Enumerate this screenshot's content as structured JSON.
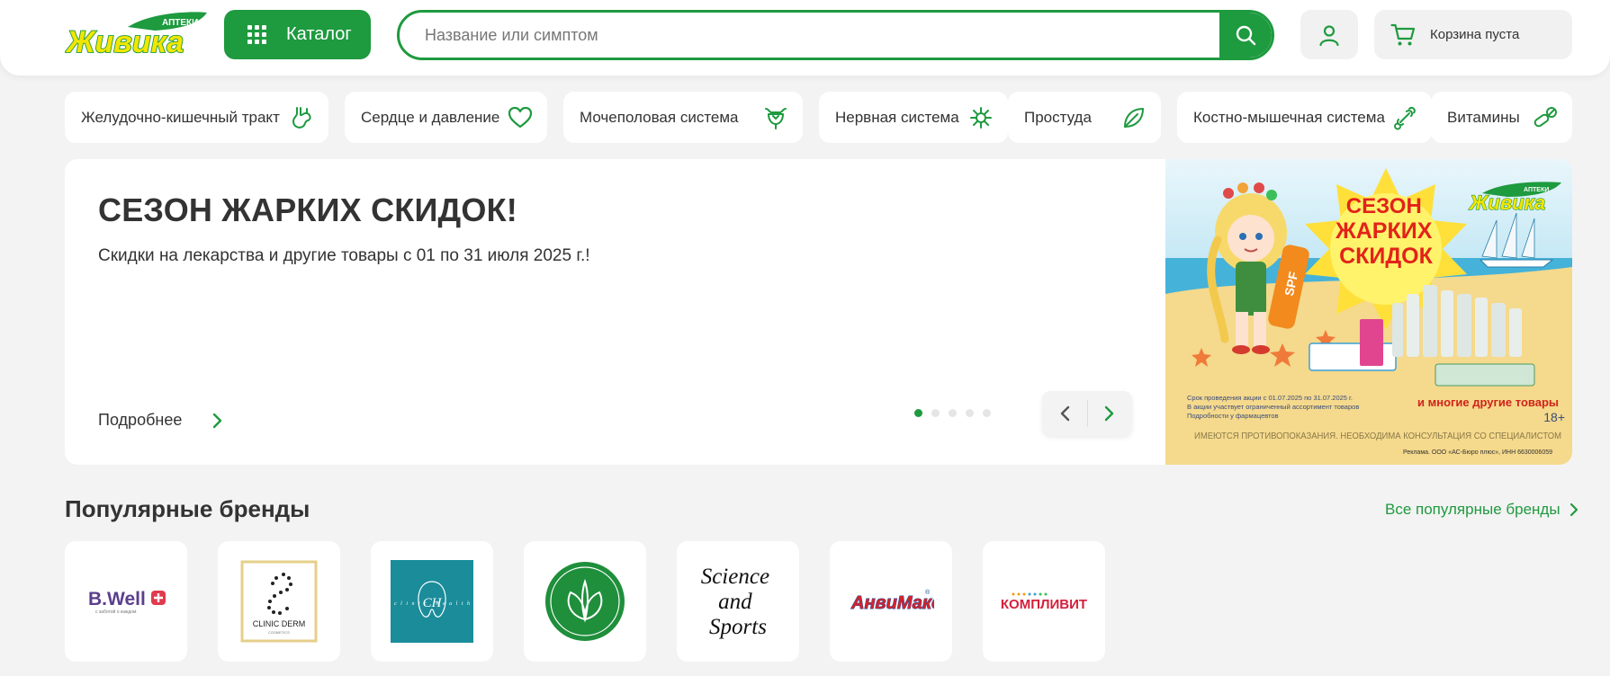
{
  "header": {
    "logo_top": "АПТЕКИ",
    "logo_main": "Живика",
    "catalog_label": "Каталог",
    "search_placeholder": "Название или симптом",
    "cart_label": "Корзина пуста"
  },
  "categories": [
    {
      "label": "Желудочно-кишечный тракт",
      "icon": "stomach-icon"
    },
    {
      "label": "Сердце и давление",
      "icon": "heart-icon"
    },
    {
      "label": "Мочеполовая система",
      "icon": "urogenital-icon"
    },
    {
      "label": "Нервная система",
      "icon": "neuron-icon"
    },
    {
      "label": "Простуда",
      "icon": "leaf-icon"
    },
    {
      "label": "Костно-мышечная система",
      "icon": "bone-icon"
    },
    {
      "label": "Витамины",
      "icon": "capsule-icon"
    }
  ],
  "banner": {
    "title": "СЕЗОН ЖАРКИХ СКИДОК!",
    "subtitle": "Скидки на лекарства и другие товары с 01 по 31 июля 2025 г.!",
    "more_label": "Подробнее",
    "slides": 5,
    "active_slide": 1
  },
  "promo": {
    "headline": [
      "СЕЗОН",
      "ЖАРКИХ",
      "СКИДОК"
    ],
    "logo_top": "АПТЕКИ",
    "logo_main": "Живика",
    "spf": "SPF",
    "more_goods": "и многие другие товары",
    "age": "18+",
    "terms": [
      "Срок проведения акции с 01.07.2025 по 31.07.2025 г.",
      "В акции участвует ограниченный ассортимент товаров",
      "Подробности у фармацевтов"
    ],
    "warning": "ИМЕЮТСЯ ПРОТИВОПОКАЗАНИЯ. НЕОБХОДИМА КОНСУЛЬТАЦИЯ СО СПЕЦИАЛИСТОМ",
    "ad_note": "Реклама. ООО «АС-Бюро плюс», ИНН 6630006059"
  },
  "brands": {
    "title": "Популярные бренды",
    "all_label": "Все популярные бренды",
    "items": [
      {
        "name": "B.Well",
        "tagline": "с заботой о каждом"
      },
      {
        "name": "CLINIC DERM",
        "tagline": "COSMETICS"
      },
      {
        "name": "clinic health",
        "monogram": "CH"
      },
      {
        "name": "leaf-brand"
      },
      {
        "name": "Science and Sports",
        "lines": [
          "Science",
          "and",
          "Sports"
        ]
      },
      {
        "name": "АнвиМакс",
        "mark": "®"
      },
      {
        "name": "КОМПЛИВИТ"
      }
    ]
  },
  "colors": {
    "brand_green": "#1e9a3f",
    "logo_yellow": "#f2e600",
    "bwell_purple": "#5b3f8c",
    "bwell_red": "#e23a4d",
    "teal": "#1b8c9a",
    "anvimax_red": "#d6232a",
    "anvimax_blue": "#1d4aa0",
    "komplivit_red": "#d41f3c"
  }
}
